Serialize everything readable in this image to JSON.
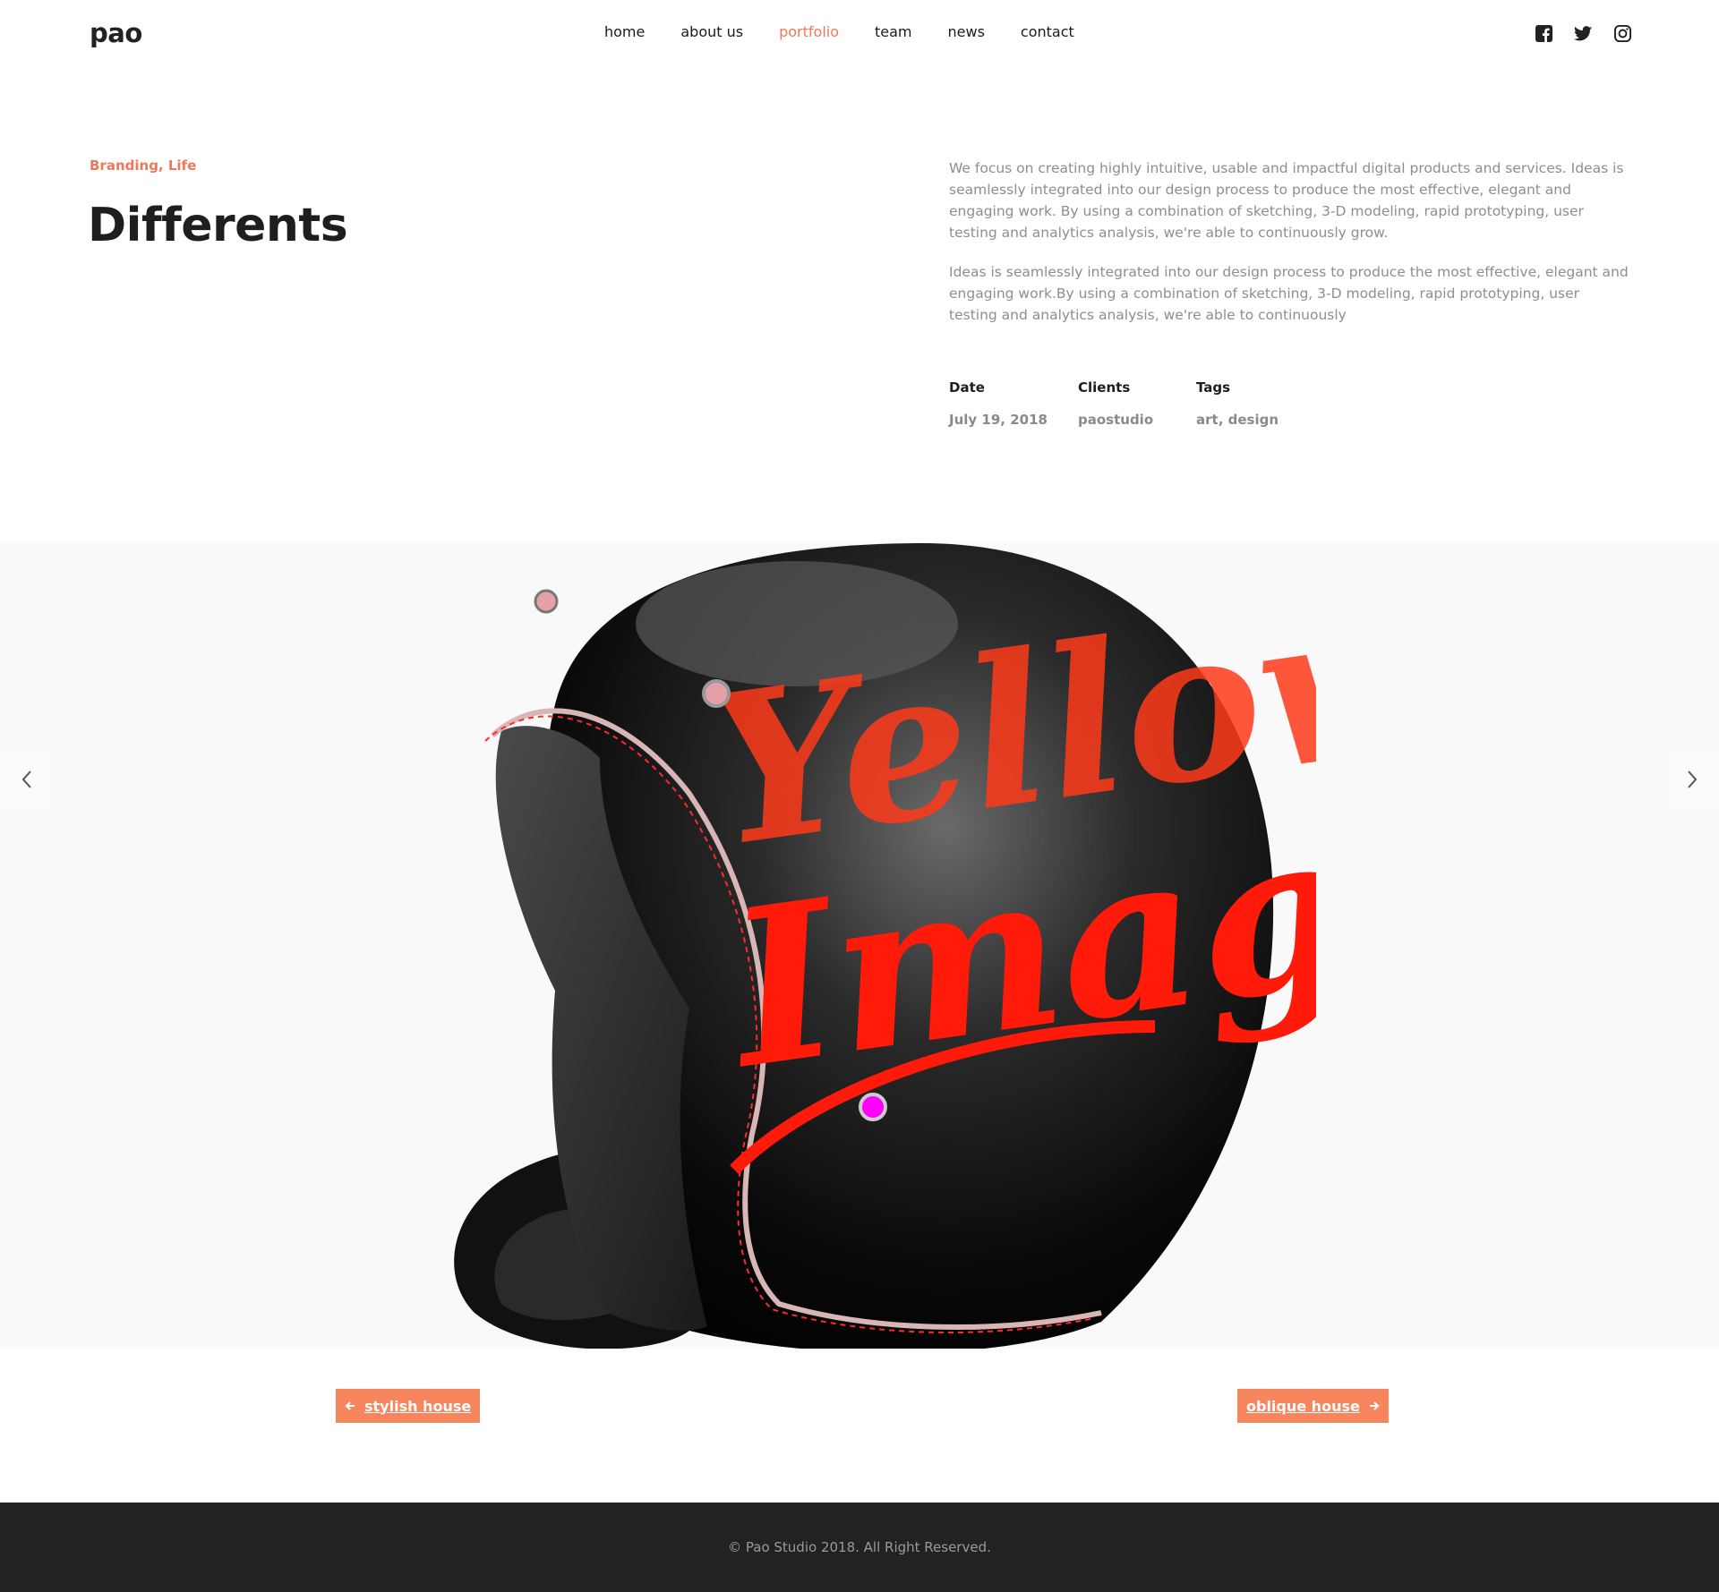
{
  "header": {
    "logo": "pao",
    "nav": [
      {
        "label": "home",
        "active": false
      },
      {
        "label": "about us",
        "active": false
      },
      {
        "label": "portfolio",
        "active": true
      },
      {
        "label": "team",
        "active": false
      },
      {
        "label": "news",
        "active": false
      },
      {
        "label": "contact",
        "active": false
      }
    ],
    "social": [
      "facebook-icon",
      "twitter-icon",
      "instagram-icon"
    ]
  },
  "project": {
    "categories": "Branding, Life",
    "title": "Differents",
    "description_1": "We focus on creating highly intuitive, usable and impactful digital products and services. Ideas is seamlessly integrated into our design process to produce the most effective, elegant and engaging work. By using a combination of sketching, 3-D modeling, rapid prototyping, user testing and analytics analysis, we're able to continuously grow.",
    "description_2": "Ideas is seamlessly integrated into our design process to produce the most effective, elegant and engaging work.By using a combination of sketching, 3-D modeling, rapid prototyping, user testing and analytics analysis, we're able to continuously",
    "meta": {
      "date_label": "Date",
      "date_value": "July 19, 2018",
      "clients_label": "Clients",
      "clients_value": "paostudio",
      "tags_label": "Tags",
      "tags_value": "art, design"
    }
  },
  "slider": {
    "image_text": "Yellow Image",
    "prev_icon": "chevron-left-icon",
    "next_icon": "chevron-right-icon"
  },
  "pager": {
    "prev_label": "stylish house",
    "next_label": "oblique house"
  },
  "footer": {
    "copyright": "© Pao Studio 2018. All Right Reserved."
  },
  "colors": {
    "accent": "#f0785a",
    "button": "#f7865e",
    "footer_bg": "#222222"
  }
}
